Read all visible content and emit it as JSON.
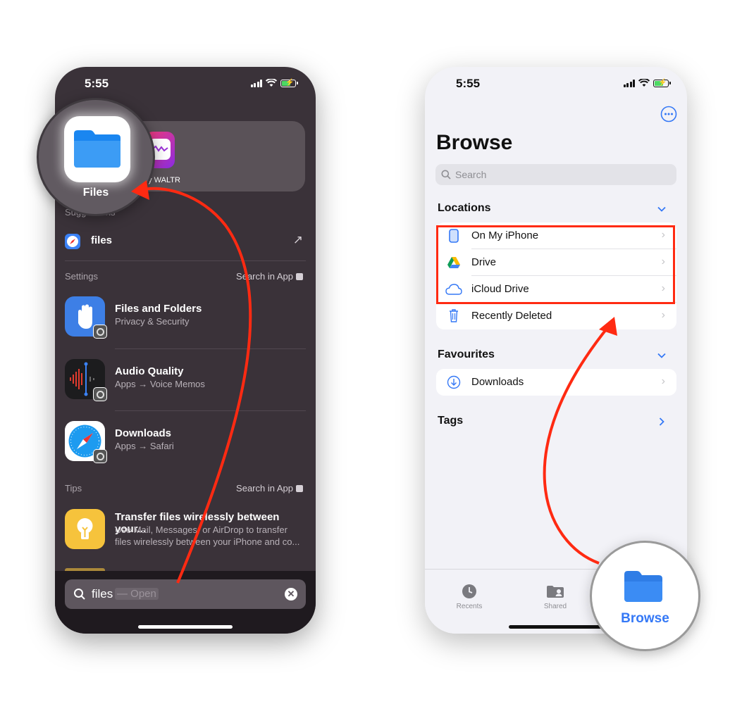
{
  "left_phone": {
    "status_time": "5:55",
    "top_app_label": "by WALTR",
    "magnifier_app_label": "Files",
    "suggestions_header": "Suggestions",
    "suggestion": {
      "label": "files"
    },
    "settings_header": "Settings",
    "settings_link": "Search in App",
    "settings_rows": [
      {
        "title": "Files and Folders",
        "subtitle": "Privacy & Security"
      },
      {
        "title": "Audio Quality",
        "subtitle": "Apps → Voice Memos"
      },
      {
        "title": "Downloads",
        "subtitle": "Apps → Safari"
      }
    ],
    "tips_header": "Tips",
    "tips_link": "Search in App",
    "tip": {
      "title": "Transfer files wirelessly between your...",
      "line1": "Use Mail, Messages, or AirDrop to transfer",
      "line2": "files wirelessly between your iPhone and co..."
    },
    "search": {
      "query": "files",
      "suggestion": "— Open"
    }
  },
  "right_phone": {
    "status_time": "5:55",
    "title": "Browse",
    "search_placeholder": "Search",
    "locations_header": "Locations",
    "locations": [
      {
        "label": "On My iPhone",
        "icon": "iphone-icon"
      },
      {
        "label": "Drive",
        "icon": "google-drive-icon"
      },
      {
        "label": "iCloud Drive",
        "icon": "icloud-icon"
      },
      {
        "label": "Recently Deleted",
        "icon": "trash-icon"
      }
    ],
    "favourites_header": "Favourites",
    "favourites": [
      {
        "label": "Downloads",
        "icon": "download-icon"
      }
    ],
    "tags_header": "Tags",
    "tabs": [
      {
        "label": "Recents",
        "icon": "clock-icon"
      },
      {
        "label": "Shared",
        "icon": "shared-folder-icon"
      },
      {
        "label": "Browse",
        "icon": "folder-icon",
        "selected": true
      }
    ]
  },
  "colors": {
    "accent": "#3478f6",
    "annotation_red": "#ff2a12",
    "dark_bg": "#3a3239"
  }
}
